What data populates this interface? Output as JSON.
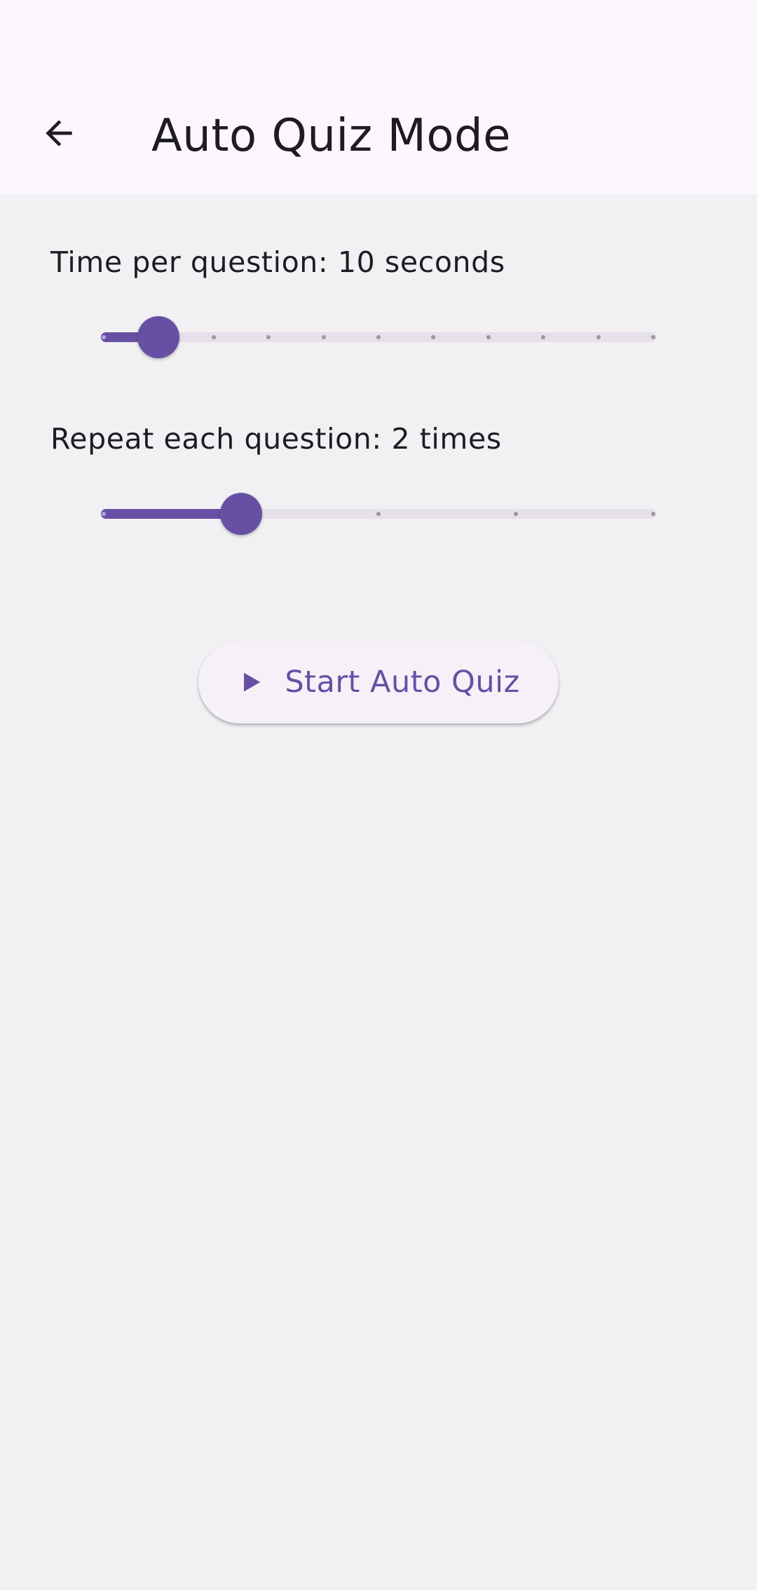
{
  "header": {
    "title": "Auto Quiz Mode",
    "back_icon": "arrow-back-icon"
  },
  "settings": {
    "time_per_question": {
      "label": "Time per question: 10 seconds",
      "value_fraction": 0.1,
      "tick_count": 11
    },
    "repeat_each_question": {
      "label": "Repeat each question: 2 times",
      "value_fraction": 0.25,
      "tick_count": 5
    }
  },
  "start_button": {
    "label": "Start Auto Quiz",
    "icon": "play-icon"
  },
  "colors": {
    "accent": "#6750a4",
    "app_bar_background": "#fdf7fd",
    "page_background": "#f1f0f3",
    "button_background": "#f6f1f8",
    "inactive_track": "#e7e0eb"
  }
}
